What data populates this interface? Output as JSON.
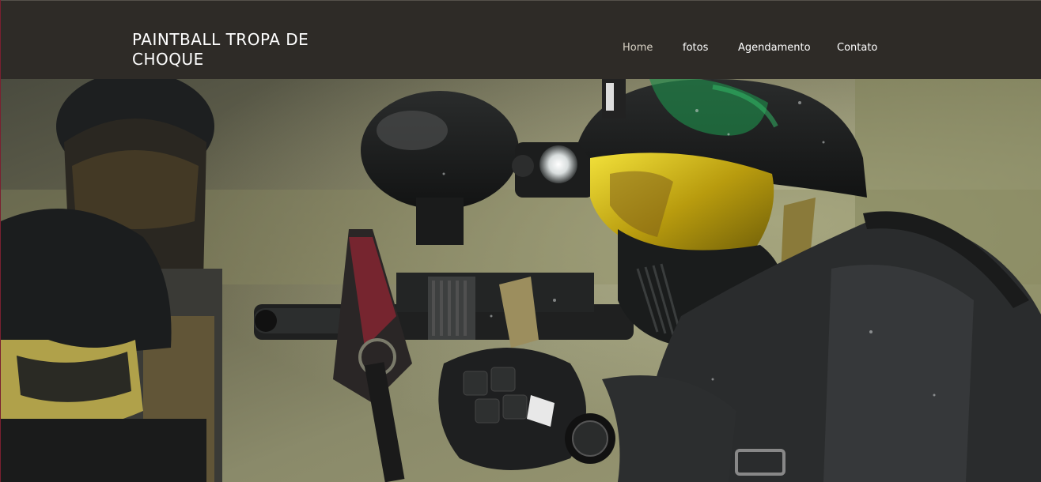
{
  "header": {
    "site_title": "PAINTBALL TROPA DE CHOQUE"
  },
  "nav": {
    "items": [
      {
        "label": "Home",
        "active": true
      },
      {
        "label": "fotos",
        "active": false
      },
      {
        "label": "Agendamento",
        "active": false
      },
      {
        "label": "Contato",
        "active": false
      }
    ]
  },
  "hero": {
    "image": "paintball-players-photo"
  },
  "colors": {
    "header_bg": "#2e2b27",
    "nav_active": "#d8d2c5",
    "nav_text": "#ffffff",
    "goggle_yellow": "#c9b21a",
    "paint_green": "#1f8a4a"
  }
}
